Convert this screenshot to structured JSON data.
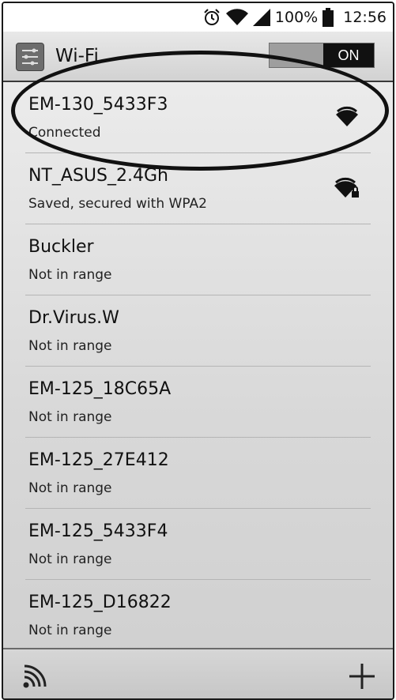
{
  "status_bar": {
    "battery_percent": "100%",
    "time": "12:56",
    "icons": [
      "alarm-clock-icon",
      "wifi-signal-icon",
      "cell-signal-icon",
      "battery-icon"
    ]
  },
  "action_bar": {
    "title": "Wi-Fi",
    "app_icon": "settings-sliders-icon",
    "toggle_label": "ON",
    "toggle_state": "on"
  },
  "networks": [
    {
      "name": "EM-130_5433F3",
      "status": "Connected",
      "signal_icon": "wifi-signal-icon",
      "secured": false
    },
    {
      "name": "NT_ASUS_2.4Gh",
      "status": "Saved, secured with WPA2",
      "signal_icon": "wifi-locked-icon",
      "secured": true
    },
    {
      "name": "Buckler",
      "status": "Not in range"
    },
    {
      "name": "Dr.Virus.W",
      "status": "Not in range"
    },
    {
      "name": "EM-125_18C65A",
      "status": "Not in range"
    },
    {
      "name": "EM-125_27E412",
      "status": "Not in range"
    },
    {
      "name": "EM-125_5433F4",
      "status": "Not in range"
    },
    {
      "name": "EM-125_D16822",
      "status": "Not in range"
    }
  ],
  "bottom_bar": {
    "left_icon": "wps-icon",
    "right_icon": "add-icon"
  },
  "colors": {
    "toggle_on": "#111111",
    "toggle_track": "#9e9e9e",
    "highlight": "#111111"
  }
}
